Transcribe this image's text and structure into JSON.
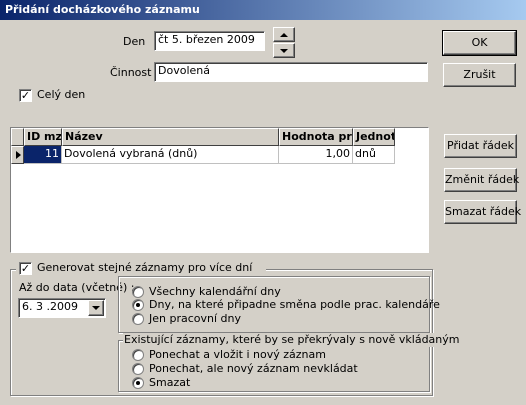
{
  "window": {
    "title": "Přidání docházkového záznamu"
  },
  "form": {
    "den_label": "Den",
    "den_value": "čt 5. březen 2009",
    "cinnost_label": "Činnost",
    "cinnost_value": "Dovolená",
    "cely_den_label": "Celý den",
    "cely_den_checked": true
  },
  "buttons": {
    "ok": "OK",
    "cancel": "Zrušit",
    "add_row": "Přidat řádek",
    "edit_row": "Změnit řádek",
    "delete_row": "Smazat řádek"
  },
  "table": {
    "columns": [
      "ID mz",
      "Název",
      "Hodnota pro",
      "Jednot"
    ],
    "rows": [
      {
        "id": "11",
        "name": "Dovolená vybraná (dnů)",
        "value": "1,00",
        "unit": "dnů"
      }
    ]
  },
  "generate": {
    "label": "Generovat stejné záznamy pro více dní",
    "checked": true,
    "until_label": "Až do data (včetně) :",
    "until_value": "6. 3 .2009",
    "days_options": [
      "Všechny kalendářní dny",
      "Dny, na které připadne směna podle prac. kalendáře",
      "Jen pracovní dny"
    ],
    "days_selected": 1,
    "existing_label": "Existující záznamy, které by se překrývaly s nově vkládaným",
    "existing_options": [
      "Ponechat a vložit i nový záznam",
      "Ponechat, ale nový záznam nevkládat",
      "Smazat"
    ],
    "existing_selected": 2
  }
}
